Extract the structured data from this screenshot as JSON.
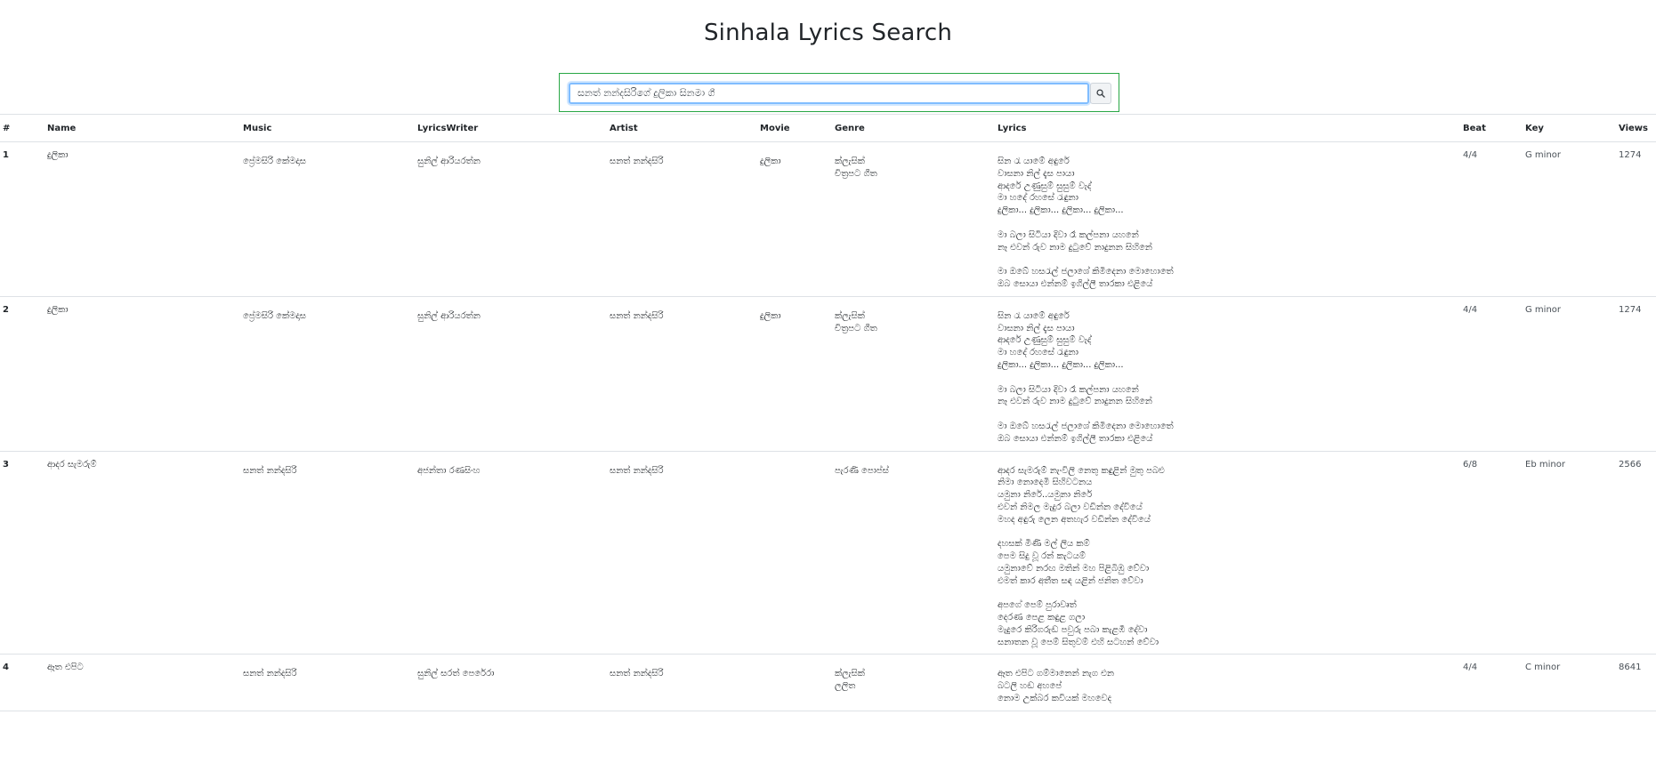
{
  "page": {
    "title": "Sinhala Lyrics Search"
  },
  "search": {
    "value": "සනත් නන්දසිරිගේ දුලිකා සිනමා ගී",
    "button_icon": "search-icon"
  },
  "table": {
    "headers": [
      "#",
      "Name",
      "Music",
      "LyricsWriter",
      "Artist",
      "Movie",
      "Genre",
      "Lyrics",
      "Beat",
      "Key",
      "Views"
    ],
    "rows": [
      {
        "num": "1",
        "name": "දුලිකා",
        "music": "ප්‍රේමසිරි කේමදාස",
        "lyrics_writer": "සුනිල් ආරියරත්න",
        "artist": "සනත් නන්දසිරි",
        "movie": "දුලිකා",
        "genre": [
          "ක්ලැසික්",
          "චිත්‍රපට ගීත"
        ],
        "lyrics": [
          "සින රැ යාමේ අඳුරේ",
          "වාසනා නිල් දැස පායා",
          "ආදරේ උණුසුම් සුසුම් වැද්",
          "මා හදේ රහසේ රැඳුනා",
          "දුලිකා... දුලිකා... දුලිකා... දුලිකා...",
          "",
          "මා බලා සිටියා දිවා රෑ කල්පනා යහනේ",
          "නෑ එවන් රුව නාම දුටුවේ නාදුනන සිහිනේ",
          "",
          "මා ඔබේ හසරැල් ජලාශේ කිමිදෙනා මොහොතේ",
          "ඔබ සොයා එන්නම් ඉගිල්ලී තාරකා එළියේ"
        ],
        "beat": "4/4",
        "key": "G minor",
        "views": "1274"
      },
      {
        "num": "2",
        "name": "දුලිකා",
        "music": "ප්‍රේමසිරි කේමදාස",
        "lyrics_writer": "සුනිල් ආරියරත්න",
        "artist": "සනත් නන්දසිරි",
        "movie": "දුලිකා",
        "genre": [
          "ක්ලැසික්",
          "චිත්‍රපට ගීත"
        ],
        "lyrics": [
          "සින රැ යාමේ අඳුරේ",
          "වාසනා නිල් දැස පායා",
          "ආදරේ උණුසුම් සුසුම් වැද්",
          "මා හදේ රහසේ රැඳුනා",
          "දුලිකා... දුලිකා... දුලිකා... දුලිකා...",
          "",
          "මා බලා සිටියා දිවා රෑ කල්පනා යහනේ",
          "නෑ එවන් රුව නාම දුටුවේ නාදුනන සිහිනේ",
          "",
          "මා ඔබේ හසරැල් ජලාශේ කිමිදෙනා මොහොතේ",
          "ඔබ සොයා එන්නම් ඉගිල්ලී තාරකා එළියේ"
        ],
        "beat": "4/4",
        "key": "G minor",
        "views": "1274"
      },
      {
        "num": "3",
        "name": "ආදර සැමරුම්",
        "music": "සනත් නන්දසිරි",
        "lyrics_writer": "අජන්තා රණසිංහ",
        "artist": "සනත් නන්දසිරි",
        "movie": "",
        "genre": [
          "පැරණි පොප්ස්"
        ],
        "lyrics": [
          "ආදර සැමරුම් නැංවිලි නෙතු කඳුළින් මුතු පබළු",
          "නිමා නොදෙමි සිහිවටනය",
          "යමුනා නිරේ..යමුනා නිරේ",
          "එවන් නිමල මැදුර බලා වඩින්න දේවියේ",
          "මහද අඳුරු ලෙන අතහැර වඩින්න දේවියේ",
          "",
          "දහසක් මිණි මල් ලිය කම්",
          "පෙම සිදු වූ රන් කැටයම්",
          "යමුනාවේ නරඟ මතින් මහ පිළිබිඹු වේවා",
          "එමත් කාර අතීත සඳ යළින් ජනිත වේවා",
          "",
          "අපගේ පෙම් පුරාවෘත්",
          "දෙරණ පෙළ කඳුළ ගලා",
          "මැදුරෙ කිරිගරුඬ පවුරු පබා කැළඹී දේවා",
          "සනාතන වූ පෙම් සිතුවම් එහි සටහන් වේවා"
        ],
        "beat": "6/8",
        "key": "Eb minor",
        "views": "2566"
      },
      {
        "num": "4",
        "name": "ඈත එපිට",
        "music": "සනත් නන්දසිරි",
        "lyrics_writer": "සුනිල් සරත් පෙරේරා",
        "artist": "සනත් නන්දසිරි",
        "movie": "",
        "genre": [
          "ක්ලැසික්",
          "ලලිත"
        ],
        "lyrics": [
          "ඈත එපිට ගම්මානෙන් නැග එන",
          "බටලි හඬ අහපේ",
          "නොම උක්බර කවියක් මහවෙද"
        ],
        "beat": "4/4",
        "key": "C minor",
        "views": "8641"
      }
    ]
  }
}
